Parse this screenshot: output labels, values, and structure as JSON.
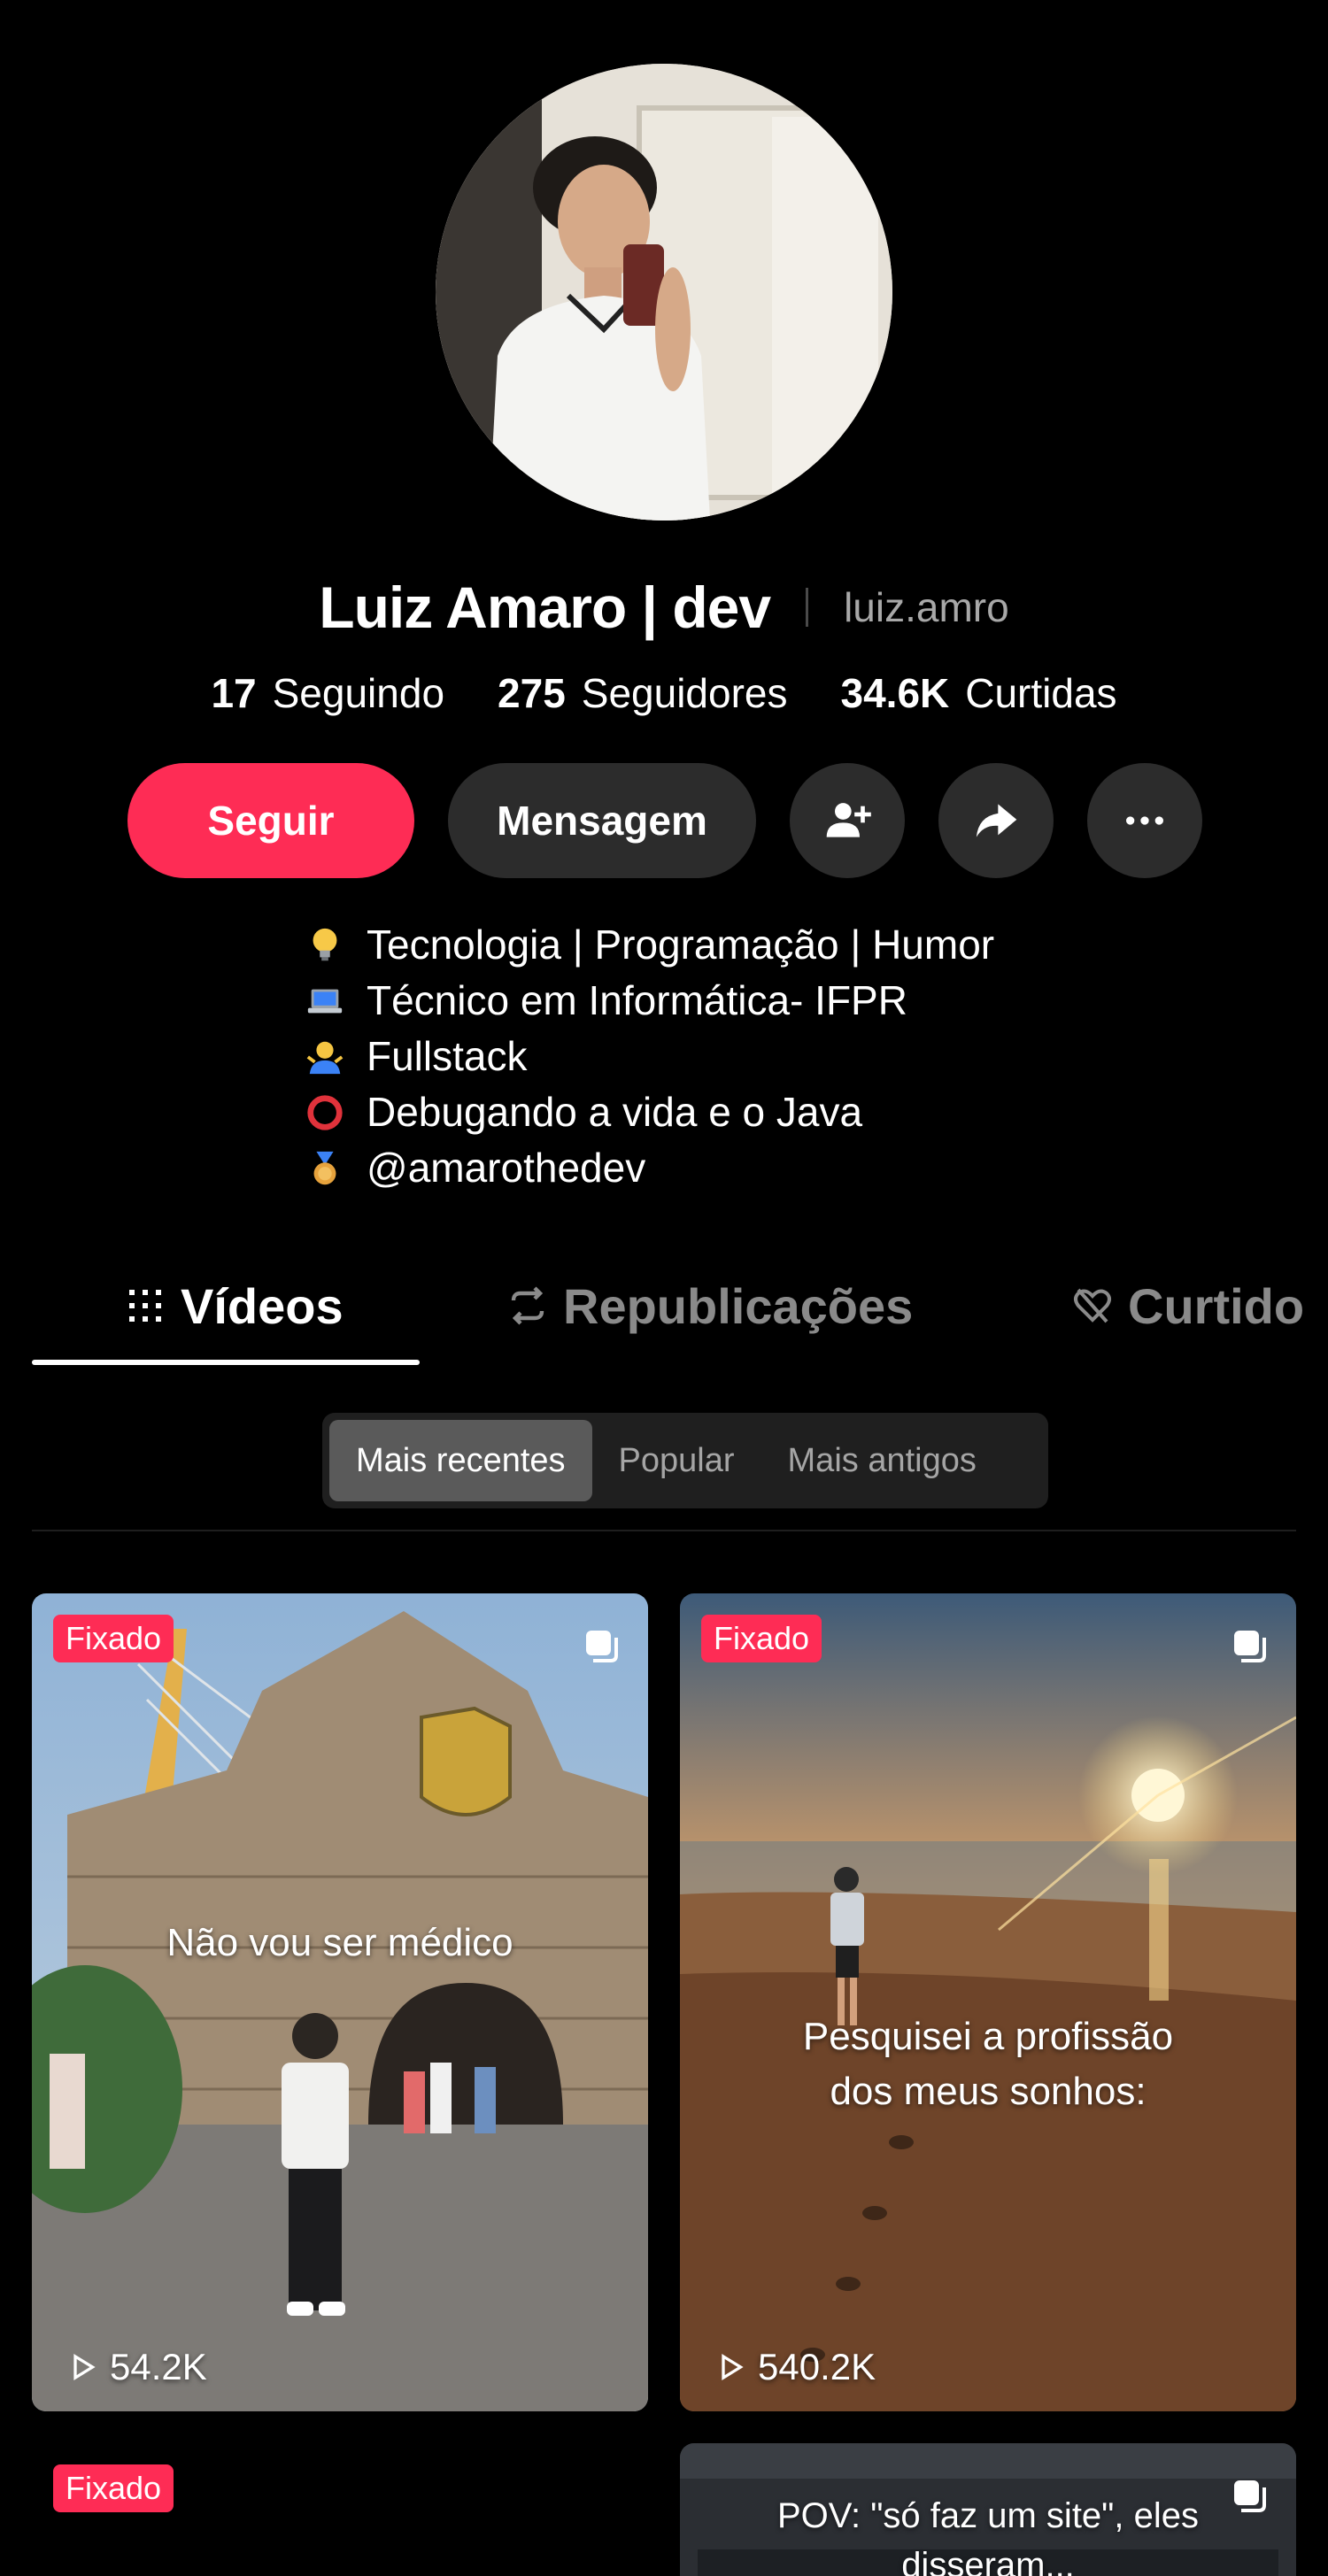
{
  "profile": {
    "display_name": "Luiz Amaro | dev",
    "username": "luiz.amro",
    "stats": [
      {
        "value": "17",
        "label": "Seguindo"
      },
      {
        "value": "275",
        "label": "Seguidores"
      },
      {
        "value": "34.6K",
        "label": "Curtidas"
      }
    ]
  },
  "actions": {
    "follow_label": "Seguir",
    "message_label": "Mensagem",
    "add_friend_icon": "add-person-icon",
    "share_icon": "share-icon",
    "more_icon": "more-icon"
  },
  "bio": [
    {
      "icon": "lightbulb-emoji",
      "text": "Tecnologia | Programação | Humor"
    },
    {
      "icon": "laptop-emoji",
      "text": "Técnico em Informática- IFPR"
    },
    {
      "icon": "person-shrugging-emoji",
      "text": "Fullstack"
    },
    {
      "icon": "red-circle-emoji",
      "text": "Debugando a vida e o Java"
    },
    {
      "icon": "medal-emoji",
      "text": "@amarothedev"
    }
  ],
  "tabs": [
    {
      "label": "Vídeos",
      "icon": "grid-icon",
      "active": true
    },
    {
      "label": "Republicações",
      "icon": "repost-icon",
      "active": false
    },
    {
      "label": "Curtido",
      "icon": "heart-hidden-icon",
      "active": false
    }
  ],
  "sort": {
    "options": [
      "Mais recentes",
      "Popular",
      "Mais antigos"
    ],
    "selected": "Mais recentes"
  },
  "videos": [
    {
      "pinned_label": "Fixado",
      "caption": "Não vou ser médico",
      "views": "54.2K",
      "multi": true
    },
    {
      "pinned_label": "Fixado",
      "caption": "Pesquisei a profissão dos meus sonhos:",
      "views": "540.2K",
      "multi": true
    },
    {
      "pinned_label": "Fixado",
      "caption": "",
      "views": "",
      "multi": false
    },
    {
      "pinned_label": "",
      "caption": "POV: \"só faz um site\", eles disseram...",
      "views": "",
      "multi": true
    }
  ],
  "colors": {
    "accent": "#fe2c55",
    "background": "#000000",
    "button_dark": "#2c2c2c",
    "muted_text": "#a8a8a8"
  }
}
